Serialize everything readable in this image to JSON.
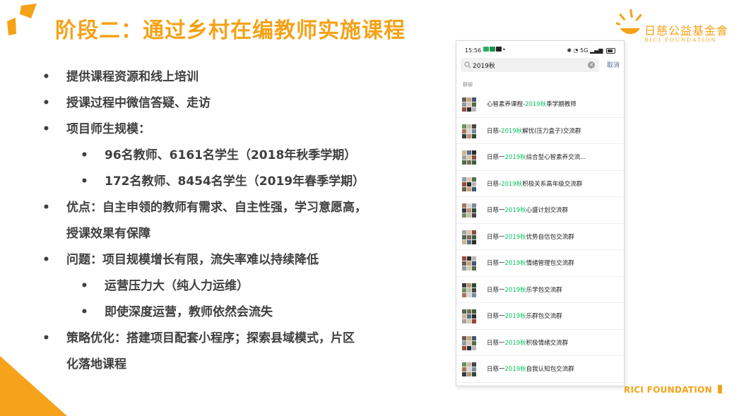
{
  "slide": {
    "title": "阶段二：通过乡村在编教师实施课程",
    "logo_cn": "日慈公益基金會",
    "logo_en": "RICI FOUNDATION",
    "footer": "RICI FOUNDATION",
    "accent_color": "#f5a218"
  },
  "bullets": [
    {
      "text": "提供课程资源和线上培训",
      "level": 1
    },
    {
      "text": "授课过程中微信答疑、走访",
      "level": 1
    },
    {
      "text": "项目师生规模：",
      "level": 1
    },
    {
      "text": "96名教师、6161名学生（2018年秋季学期）",
      "level": 2
    },
    {
      "text": "172名教师、8454名学生（2019年春季学期）",
      "level": 2
    },
    {
      "text": "优点：自主申领的教师有需求、自主性强，学习意愿高，",
      "level": 1
    },
    {
      "text": "授课效果有保障",
      "level": 0
    },
    {
      "text": "问题：项目规模增长有限，流失率难以持续降低",
      "level": 1
    },
    {
      "text": "运营压力大（纯人力运维）",
      "level": 2
    },
    {
      "text": "即使深度运营，教师依然会流失",
      "level": 2
    },
    {
      "text": "策略优化：搭建项目配套小程序；探索县域模式，片区",
      "level": 1
    },
    {
      "text": "化落地课程",
      "level": 0
    }
  ],
  "phone": {
    "status_time": "15:56",
    "status_signal": "5G",
    "search_value": "2019秋",
    "cancel_label": "取消",
    "section_label": "群聊",
    "highlight_color": "#07c160",
    "groups": [
      {
        "pre": "心智素养课程-",
        "hl": "2019秋",
        "post": "季学期教师"
      },
      {
        "pre": "日慈-",
        "hl": "2019秋",
        "post": "解忧(压力盒子)交流群"
      },
      {
        "pre": "日慈一",
        "hl": "2019秋",
        "post": "综合型心智素养交流..."
      },
      {
        "pre": "日慈-",
        "hl": "2019秋",
        "post": "积极关系高年级交流群"
      },
      {
        "pre": "日慈一",
        "hl": "2019秋",
        "post": "心盛计划交流群"
      },
      {
        "pre": "日慈一",
        "hl": "2019秋",
        "post": "优势自信包交流群"
      },
      {
        "pre": "日慈一",
        "hl": "2019秋",
        "post": "情绪管理包交流群"
      },
      {
        "pre": "日慈一",
        "hl": "2019秋",
        "post": "乐学包交流群"
      },
      {
        "pre": "日慈一",
        "hl": "2019秋",
        "post": "乐群包交流群"
      },
      {
        "pre": "日慈一",
        "hl": "2019秋",
        "post": "积极情绪交流群"
      },
      {
        "pre": "日慈一",
        "hl": "2019秋",
        "post": "自我认知包交流群"
      }
    ]
  }
}
